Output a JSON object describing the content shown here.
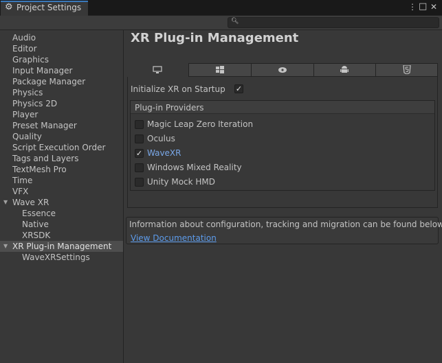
{
  "window": {
    "tab_title": "Project Settings",
    "tab_icon": "gear-icon",
    "menu_icon": "kebab-menu-icon",
    "maximize_icon": "maximize-icon",
    "close_icon": "close-icon",
    "close_glyph": "✕",
    "maximize_glyph": "□",
    "menu_glyph": "⋮"
  },
  "search": {
    "placeholder": "",
    "value": "",
    "icon": "search-icon"
  },
  "sidebar": {
    "items": [
      {
        "label": "Audio"
      },
      {
        "label": "Editor"
      },
      {
        "label": "Graphics"
      },
      {
        "label": "Input Manager"
      },
      {
        "label": "Package Manager"
      },
      {
        "label": "Physics"
      },
      {
        "label": "Physics 2D"
      },
      {
        "label": "Player"
      },
      {
        "label": "Preset Manager"
      },
      {
        "label": "Quality"
      },
      {
        "label": "Script Execution Order"
      },
      {
        "label": "Tags and Layers"
      },
      {
        "label": "TextMesh Pro"
      },
      {
        "label": "Time"
      },
      {
        "label": "VFX"
      },
      {
        "label": "Wave XR",
        "expanded": true
      },
      {
        "label": "Essence",
        "child": true
      },
      {
        "label": "Native",
        "child": true
      },
      {
        "label": "XRSDK",
        "child": true
      },
      {
        "label": "XR Plug-in Management",
        "expanded": true,
        "selected": true
      },
      {
        "label": "WaveXRSettings",
        "child": true
      }
    ]
  },
  "main": {
    "title": "XR Plug-in Management",
    "platform_tabs": [
      {
        "icon": "desktop-icon",
        "active": true
      },
      {
        "icon": "windows-icon",
        "active": false
      },
      {
        "icon": "lumin-icon",
        "active": false
      },
      {
        "icon": "android-icon",
        "active": false
      },
      {
        "icon": "html5-icon",
        "active": false
      }
    ],
    "init_label": "Initialize XR on Startup",
    "init_checked": true,
    "providers_title": "Plug-in Providers",
    "providers": [
      {
        "label": "Magic Leap Zero Iteration",
        "checked": false
      },
      {
        "label": "Oculus",
        "checked": false
      },
      {
        "label": "WaveXR",
        "checked": true
      },
      {
        "label": "Windows Mixed Reality",
        "checked": false
      },
      {
        "label": "Unity Mock HMD",
        "checked": false
      }
    ],
    "info_text": "Information about configuration, tracking and migration can be found below.",
    "doc_link": "View Documentation"
  },
  "colors": {
    "background": "#383838",
    "tabbar": "#191919",
    "accent_tab": "#3a79bb",
    "selected_row": "#4d4d4d",
    "link": "#5d9cec",
    "checked_provider": "#7aa8e8",
    "text": "#c4c4c4"
  }
}
